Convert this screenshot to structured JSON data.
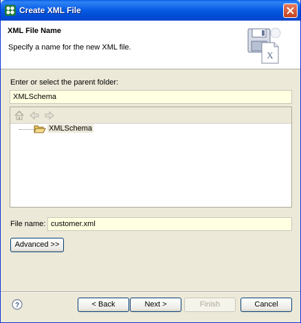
{
  "window": {
    "title": "Create XML File"
  },
  "header": {
    "title": "XML File Name",
    "description": "Specify a name for the new XML file."
  },
  "parent_folder": {
    "label": "Enter or select the parent folder:",
    "value": "XMLSchema"
  },
  "tree": {
    "toolbar": [
      "home-icon",
      "back-arrow-icon",
      "forward-arrow-icon"
    ],
    "items": [
      {
        "label": "XMLSchema",
        "icon": "open-folder-icon"
      }
    ]
  },
  "file_name": {
    "label": "File name:",
    "value": "customer.xml"
  },
  "advanced_button": "Advanced >>",
  "footer": {
    "help_icon": "help-icon",
    "back": "< Back",
    "next": "Next >",
    "finish": "Finish",
    "cancel": "Cancel"
  },
  "colors": {
    "titlebar": "#0A5FE6",
    "dialog_bg": "#ECE9D8",
    "input_bg": "#FFFFE1"
  }
}
